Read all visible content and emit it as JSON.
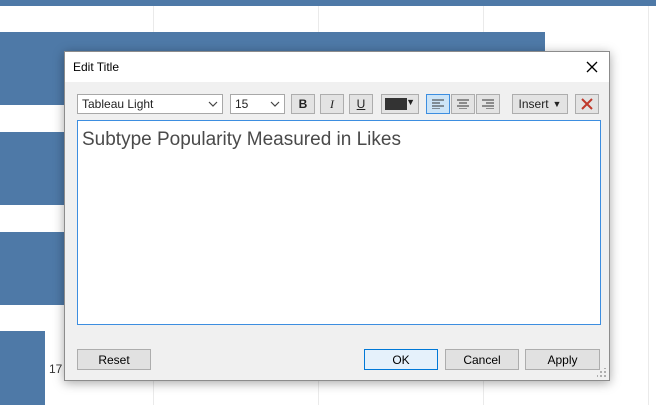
{
  "background_chart": {
    "bar_color": "#4e79a7",
    "bars": [
      {
        "value": 545
      },
      {
        "value": 66
      },
      {
        "value": 66
      },
      {
        "value": 45
      }
    ],
    "partial_label": "17"
  },
  "dialog": {
    "title": "Edit Title",
    "close_icon": "close-icon",
    "toolbar": {
      "font_family": "Tableau Light",
      "font_size": "15",
      "bold_label": "B",
      "italic_label": "I",
      "underline_label": "U",
      "text_color": "#333333",
      "align_left_active": true,
      "insert_label": "Insert",
      "clear_icon": "red-x-icon"
    },
    "editor": {
      "text": "Subtype Popularity Measured in Likes"
    },
    "buttons": {
      "reset": "Reset",
      "ok": "OK",
      "cancel": "Cancel",
      "apply": "Apply"
    }
  }
}
